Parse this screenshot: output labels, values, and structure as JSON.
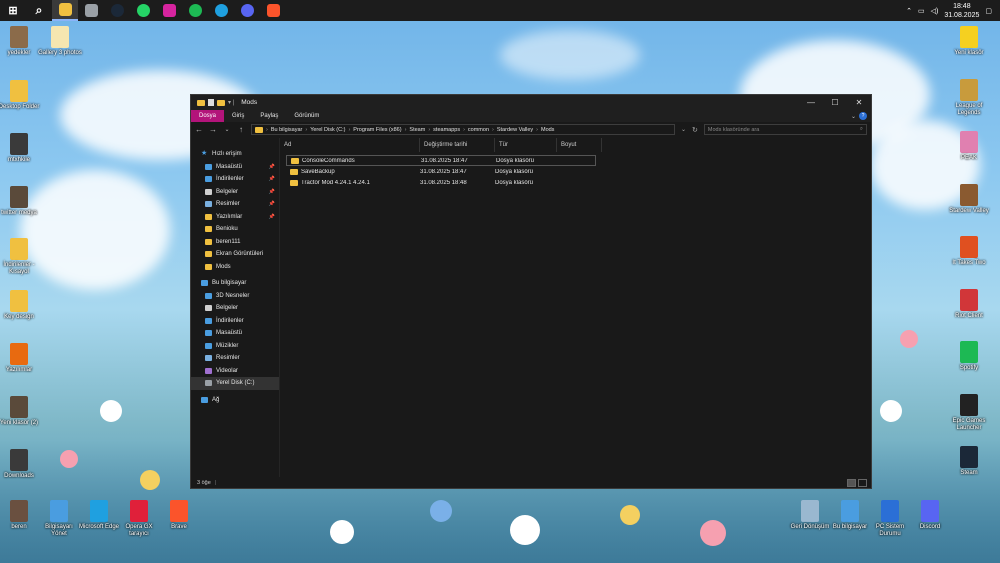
{
  "taskbar": {
    "apps": [
      {
        "icon": "windows-start-icon",
        "color": "#1c1c1c"
      },
      {
        "icon": "search-icon",
        "color": "#1c1c1c"
      },
      {
        "icon": "file-explorer-icon",
        "color": "#f0c040",
        "active": true
      },
      {
        "icon": "app-icon",
        "color": "#9aa0a6"
      },
      {
        "icon": "steam-icon",
        "color": "#1b2838"
      },
      {
        "icon": "whatsapp-icon",
        "color": "#25d366"
      },
      {
        "icon": "instagram-icon",
        "color": "#d6249f"
      },
      {
        "icon": "spotify-icon",
        "color": "#1db954"
      },
      {
        "icon": "edge-icon",
        "color": "#1fa0e0"
      },
      {
        "icon": "discord-icon",
        "color": "#5865f2"
      },
      {
        "icon": "brave-icon",
        "color": "#fb542b"
      }
    ],
    "time": "18:48",
    "date": "31.08.2025"
  },
  "desktop_left": [
    {
      "label": "yedekler",
      "color": "#8b6b4a"
    },
    {
      "label": "Gallery 3 photos",
      "color": "#f5e6b0"
    },
    {
      "label": "Desktop Folder",
      "color": "#f0c040"
    },
    {
      "label": "mtxhkile",
      "color": "#3a3a3a"
    },
    {
      "label": "twitter medya",
      "color": "#5a4a3a"
    },
    {
      "label": "İndirilenler - Kısayol",
      "color": "#f0c040"
    },
    {
      "label": "Key design",
      "color": "#f0c040"
    },
    {
      "label": "Yazılımlar",
      "color": "#e86a10"
    },
    {
      "label": "Yeni klasör (2)",
      "color": "#5a4a3a"
    },
    {
      "label": "Downloads",
      "color": "#3a3a3a"
    },
    {
      "label": "beren",
      "color": "#6a5040"
    }
  ],
  "desktop_bottom": [
    {
      "label": "Bilgisayarı Yönet",
      "color": "#4a9de0"
    },
    {
      "label": "Microsoft Edge",
      "color": "#1fa0e0"
    },
    {
      "label": "Opera GX tarayıcı",
      "color": "#e0203a"
    },
    {
      "label": "Brave",
      "color": "#fb542b"
    }
  ],
  "desktop_right": [
    {
      "label": "Yeni klasör",
      "color": "#f5d020"
    },
    {
      "label": "League of Legends",
      "color": "#c89b3c"
    },
    {
      "label": "PEAK",
      "color": "#e080b0"
    },
    {
      "label": "Stardew Valley",
      "color": "#8a5a30"
    },
    {
      "label": "It Takes Two",
      "color": "#e05020"
    },
    {
      "label": "Riot Client",
      "color": "#d13639"
    },
    {
      "label": "Spotify",
      "color": "#1db954"
    },
    {
      "label": "Epic Games Launcher",
      "color": "#222222"
    },
    {
      "label": "Steam",
      "color": "#1b2838"
    }
  ],
  "desktop_bottom_right": [
    {
      "label": "Geri Dönüşüm",
      "color": "#9ab8d0"
    },
    {
      "label": "Bu bilgisayar",
      "color": "#4a9de0"
    },
    {
      "label": "PC Sistem Durumu",
      "color": "#2b6fd6"
    },
    {
      "label": "Discord",
      "color": "#5865f2"
    }
  ],
  "explorer": {
    "title": "Mods",
    "ribbon_tabs": [
      "Dosya",
      "Giriş",
      "Paylaş",
      "Görünüm"
    ],
    "breadcrumb": [
      "Bu bilgisayar",
      "Yerel Disk (C:)",
      "Program Files (x86)",
      "Steam",
      "steamapps",
      "common",
      "Stardew Valley",
      "Mods"
    ],
    "search_placeholder": "Mods klasöründe ara",
    "nav": [
      {
        "label": "Hızlı erişim",
        "top": true,
        "icon": "star-icon",
        "color": "#4a9de0"
      },
      {
        "label": "Masaüstü",
        "pinned": true,
        "icon": "desktop-icon",
        "color": "#4a9de0"
      },
      {
        "label": "İndirilenler",
        "pinned": true,
        "icon": "download-icon",
        "color": "#4a9de0"
      },
      {
        "label": "Belgeler",
        "pinned": true,
        "icon": "documents-icon",
        "color": "#d0d0d0"
      },
      {
        "label": "Resimler",
        "pinned": true,
        "icon": "pictures-icon",
        "color": "#7ab0e0"
      },
      {
        "label": "Yazılımlar",
        "pinned": true,
        "icon": "folder-icon",
        "color": "#f0c040"
      },
      {
        "label": "Benioku",
        "icon": "folder-icon",
        "color": "#f0c040"
      },
      {
        "label": "beren111",
        "icon": "folder-icon",
        "color": "#f0c040"
      },
      {
        "label": "Ekran Görüntüleri",
        "icon": "folder-icon",
        "color": "#f0c040"
      },
      {
        "label": "Mods",
        "icon": "folder-icon",
        "color": "#f0c040"
      },
      {
        "label": "Bu bilgisayar",
        "top": true,
        "icon": "computer-icon",
        "color": "#4a9de0"
      },
      {
        "label": "3D Nesneler",
        "icon": "3d-objects-icon",
        "color": "#4a9de0"
      },
      {
        "label": "Belgeler",
        "icon": "documents-icon",
        "color": "#d0d0d0"
      },
      {
        "label": "İndirilenler",
        "icon": "download-icon",
        "color": "#4a9de0"
      },
      {
        "label": "Masaüstü",
        "icon": "desktop-icon",
        "color": "#4a9de0"
      },
      {
        "label": "Müzikler",
        "icon": "music-icon",
        "color": "#4a9de0"
      },
      {
        "label": "Resimler",
        "icon": "pictures-icon",
        "color": "#7ab0e0"
      },
      {
        "label": "Videolar",
        "icon": "videos-icon",
        "color": "#a070d0"
      },
      {
        "label": "Yerel Disk (C:)",
        "icon": "drive-icon",
        "color": "#9aa0a6",
        "selected": true
      },
      {
        "label": "Ağ",
        "top": true,
        "icon": "network-icon",
        "color": "#4a9de0"
      }
    ],
    "columns": [
      "Ad",
      "Değiştirme tarihi",
      "Tür",
      "Boyut"
    ],
    "rows": [
      {
        "name": "ConsoleCommands",
        "date": "31.08.2025 18:47",
        "type": "Dosya klasörü",
        "size": ""
      },
      {
        "name": "SaveBackup",
        "date": "31.08.2025 18:47",
        "type": "Dosya klasörü",
        "size": ""
      },
      {
        "name": "Tractor Mod 4.24.1 4.24.1",
        "date": "31.08.2025 18:48",
        "type": "Dosya klasörü",
        "size": ""
      }
    ],
    "status": "3 öğe"
  }
}
